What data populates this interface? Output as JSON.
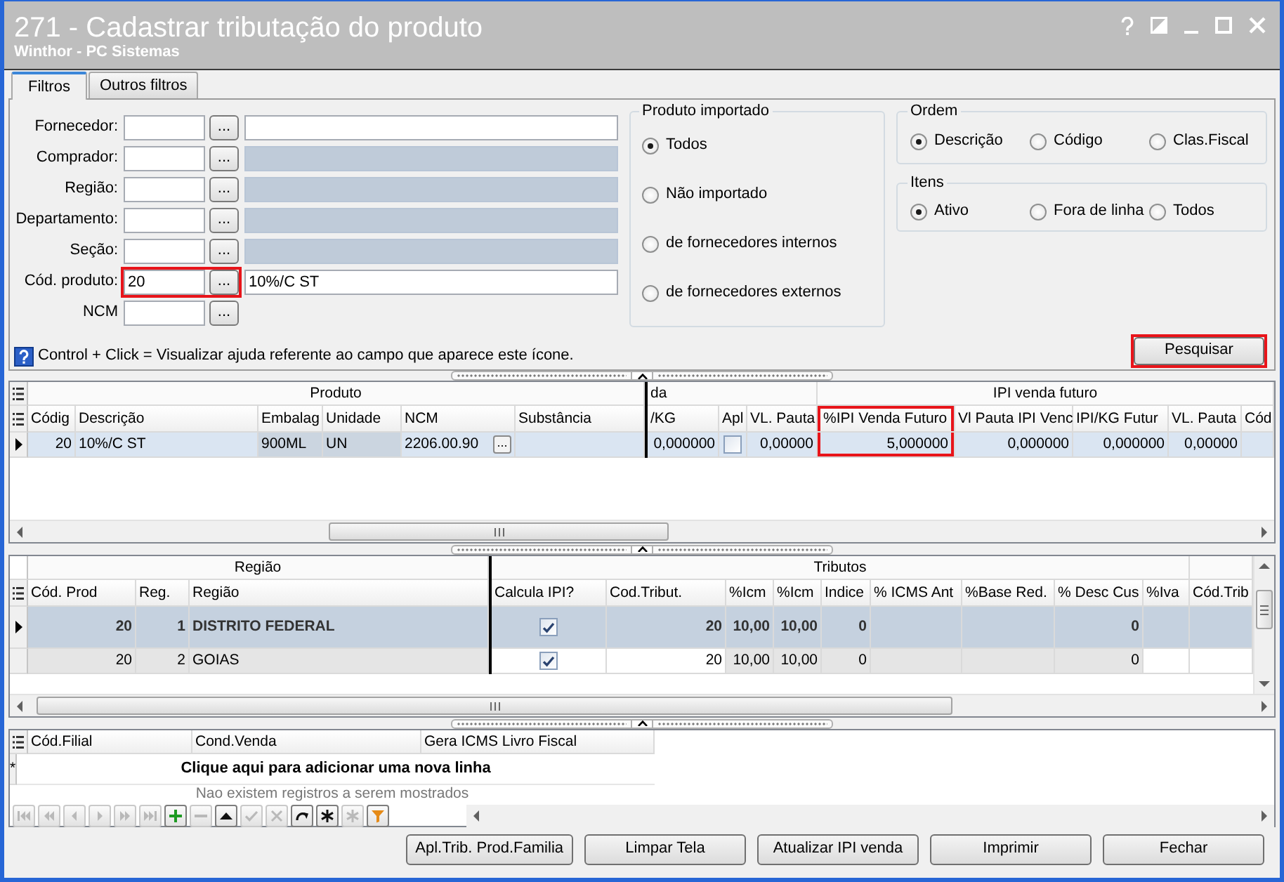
{
  "window": {
    "title": "271 - Cadastrar tributação do produto",
    "subtitle": "Winthor - PC Sistemas"
  },
  "tabs": [
    {
      "label": "Filtros",
      "selected": true
    },
    {
      "label": "Outros filtros",
      "selected": false
    }
  ],
  "filters": [
    {
      "kind": "lookup",
      "label": "Fornecedor:",
      "button": "...",
      "description_disabled": false,
      "highlighted": false
    },
    {
      "kind": "lookup",
      "label": "Comprador:",
      "button": "...",
      "description_disabled": true,
      "highlighted": false
    },
    {
      "kind": "lookup",
      "label": "Região:",
      "button": "...",
      "description_disabled": true,
      "highlighted": false
    },
    {
      "kind": "lookup",
      "label": "Departamento:",
      "button": "...",
      "description_disabled": true,
      "highlighted": false
    },
    {
      "kind": "lookup",
      "label": "Seção:",
      "button": "...",
      "description_disabled": true,
      "highlighted": false
    },
    {
      "kind": "lookup",
      "label": "Cód. produto:",
      "value": "20",
      "button": "...",
      "description": "10%/C ST",
      "description_disabled": false,
      "highlighted": true
    },
    {
      "kind": "code",
      "label": "NCM",
      "button": "...",
      "highlighted": false
    }
  ],
  "imported": {
    "title": "Produto importado",
    "options": [
      {
        "label": "Todos",
        "selected": true
      },
      {
        "label": "Não importado",
        "selected": false
      },
      {
        "label": "de fornecedores internos",
        "selected": false
      },
      {
        "label": "de fornecedores externos",
        "selected": false
      }
    ]
  },
  "order": {
    "title": "Ordem",
    "options": [
      {
        "label": "Descrição",
        "selected": true
      },
      {
        "label": "Código",
        "selected": false
      },
      {
        "label": "Clas.Fiscal",
        "selected": false
      }
    ]
  },
  "items": {
    "title": "Itens",
    "options": [
      {
        "label": "Ativo",
        "selected": true
      },
      {
        "label": "Fora de linha",
        "selected": false
      },
      {
        "label": "Todos",
        "selected": false
      }
    ]
  },
  "help_hint": "Control + Click = Visualizar ajuda referente ao campo que aparece este ícone.",
  "search_button": {
    "label": "Pesquisar",
    "highlighted": true
  },
  "product_grid": {
    "groups": [
      {
        "label": "Produto",
        "columns": [
          {
            "label": "Códig",
            "kind": "num",
            "readonly": false,
            "highlighted": false
          },
          {
            "label": "Descrição",
            "kind": "text",
            "readonly": false,
            "highlighted": false
          },
          {
            "label": "Embalag",
            "kind": "text",
            "readonly": true,
            "highlighted": false
          },
          {
            "label": "Unidade",
            "kind": "text",
            "readonly": true,
            "highlighted": false
          },
          {
            "label": "NCM",
            "kind": "lookup",
            "readonly": false,
            "highlighted": false
          },
          {
            "label": "Substância",
            "kind": "text",
            "readonly": false,
            "highlighted": false
          }
        ]
      },
      {
        "label": "da",
        "columns": [
          {
            "label": "/KG",
            "kind": "num",
            "readonly": false,
            "highlighted": false
          },
          {
            "label": "Apl",
            "kind": "check",
            "readonly": false,
            "highlighted": false
          },
          {
            "label": "VL. Pauta",
            "kind": "num",
            "readonly": false,
            "highlighted": false
          }
        ]
      },
      {
        "label": "IPI venda futuro",
        "columns": [
          {
            "label": "%IPI Venda Futuro",
            "kind": "num",
            "readonly": false,
            "highlighted": true
          },
          {
            "label": "Vl Pauta IPI Venc",
            "kind": "num",
            "readonly": false,
            "highlighted": false
          },
          {
            "label": "IPI/KG Futur",
            "kind": "num",
            "readonly": false,
            "highlighted": false
          },
          {
            "label": "VL. Pauta",
            "kind": "num",
            "readonly": false,
            "highlighted": false
          },
          {
            "label": "Cód",
            "kind": "text",
            "readonly": false,
            "highlighted": false
          }
        ]
      }
    ],
    "rows": [
      {
        "selected": true,
        "cells": [
          "20",
          "10%/C ST",
          "900ML",
          "UN",
          {
            "text": "2206.00.90",
            "button": "..."
          },
          null,
          "0,000000",
          {
            "checked": false
          },
          "0,00000",
          "5,000000",
          "0,000000",
          "0,000000",
          "0,00000",
          null
        ]
      }
    ]
  },
  "tax_grid": {
    "groups": [
      {
        "label": "Região",
        "columns": [
          {
            "label": "Cód. Prod",
            "kind": "num",
            "readonly": true
          },
          {
            "label": "Reg.",
            "kind": "num",
            "readonly": true
          },
          {
            "label": "Região",
            "kind": "text",
            "readonly": true
          }
        ]
      },
      {
        "label": "Tributos",
        "columns": [
          {
            "label": "Calcula IPI?",
            "kind": "check",
            "readonly": false
          },
          {
            "label": "Cod.Tribut.",
            "kind": "num",
            "readonly": false
          },
          {
            "label": "%Icm",
            "kind": "num",
            "readonly": true
          },
          {
            "label": "%Icm",
            "kind": "num",
            "readonly": true
          },
          {
            "label": "Indice",
            "kind": "num",
            "readonly": true
          },
          {
            "label": "% ICMS Ant",
            "kind": "num",
            "readonly": true
          },
          {
            "label": "%Base Red.",
            "kind": "num",
            "readonly": true
          },
          {
            "label": "% Desc Cus",
            "kind": "num",
            "readonly": true
          },
          {
            "label": "%Iva",
            "kind": "num",
            "readonly": false
          }
        ]
      },
      {
        "columns": [
          {
            "label": "Cód.Trib",
            "kind": "text",
            "readonly": false
          }
        ]
      }
    ],
    "rows": [
      {
        "selected": true,
        "cells": [
          "20",
          "1",
          "DISTRITO FEDERAL",
          {
            "checked": true
          },
          "20",
          "10,00",
          "10,00",
          "0",
          null,
          null,
          "0",
          null,
          null
        ]
      },
      {
        "selected": false,
        "cells": [
          "20",
          "2",
          "GOIAS",
          {
            "checked": true
          },
          "20",
          "10,00",
          "10,00",
          "0",
          null,
          null,
          "0",
          null,
          null
        ]
      }
    ]
  },
  "branch_grid": {
    "columns": [
      "Cód.Filial",
      "Cond.Venda",
      "Gera ICMS Livro Fiscal"
    ],
    "new_row_marker": "*",
    "new_row_prompt": "Clique aqui para adicionar uma nova linha",
    "empty_message": "Nao existem registros a serem mostrados",
    "navigator": [
      {
        "kind": "first",
        "disabled": true
      },
      {
        "kind": "prior-page",
        "disabled": true
      },
      {
        "kind": "prior",
        "disabled": true
      },
      {
        "kind": "next",
        "disabled": true
      },
      {
        "kind": "next-page",
        "disabled": true
      },
      {
        "kind": "last",
        "disabled": true
      },
      {
        "kind": "insert",
        "disabled": false
      },
      {
        "kind": "delete",
        "disabled": true
      },
      {
        "kind": "edit",
        "disabled": false
      },
      {
        "kind": "post",
        "disabled": true
      },
      {
        "kind": "cancel",
        "disabled": true
      },
      {
        "kind": "refresh",
        "disabled": false
      },
      {
        "kind": "asterisk",
        "disabled": false
      },
      {
        "kind": "asterisk",
        "disabled": true
      },
      {
        "kind": "filter",
        "disabled": false
      }
    ]
  },
  "footer_buttons": [
    "Apl.Trib. Prod.Familia",
    "Limpar Tela",
    "Atualizar IPI venda",
    "Imprimir",
    "Fechar"
  ]
}
